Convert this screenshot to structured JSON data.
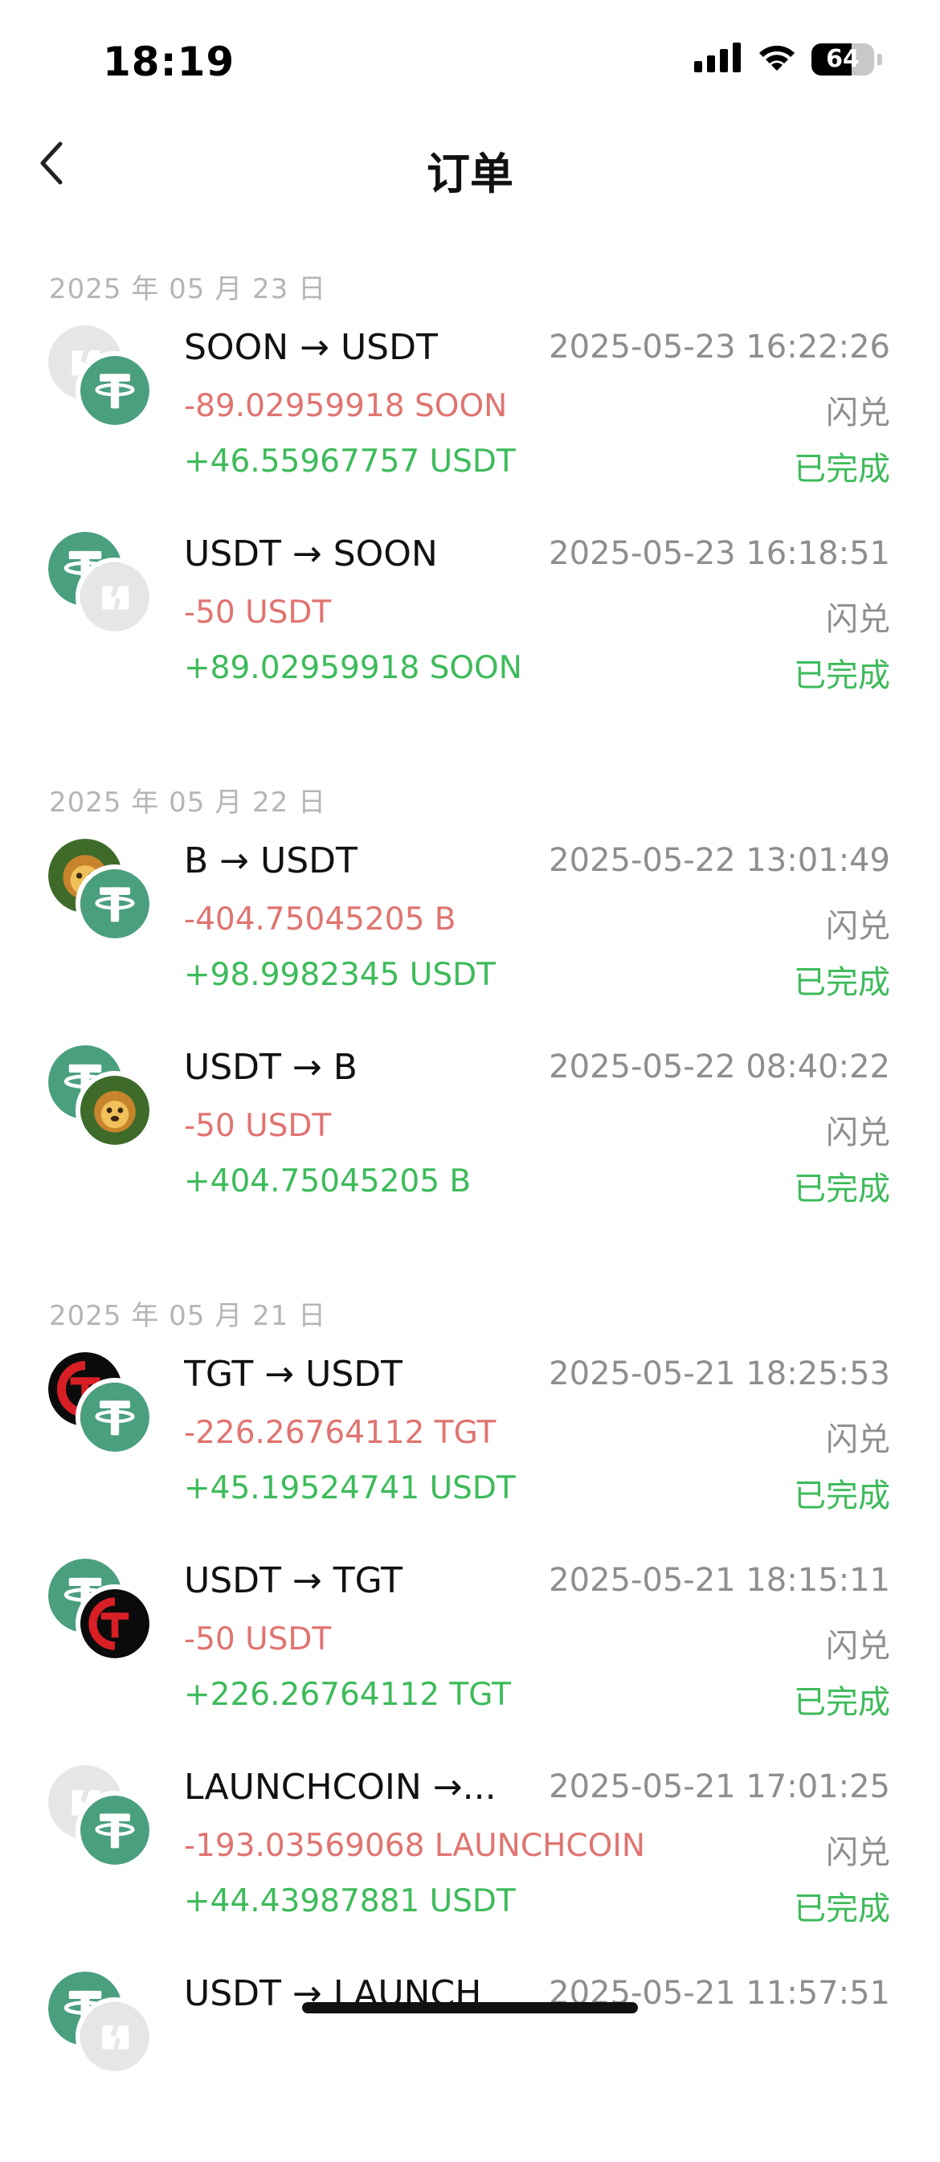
{
  "status_bar": {
    "time": "18:19",
    "battery": "64",
    "battery_level": 0.64,
    "icons": [
      "cellular-signal-icon",
      "wifi-icon",
      "battery-icon"
    ]
  },
  "nav": {
    "back_icon": "chevron-left-icon",
    "title": "订单"
  },
  "colors": {
    "outflow": "#e07471",
    "inflow": "#3dbb5a",
    "muted": "#8e8e8e",
    "date_header": "#b5b5b5",
    "usdt_green": "#4a9f7e"
  },
  "groups": [
    {
      "date": "2025 年 05 月 23 日",
      "orders": [
        {
          "from_icon": "soon-token-icon",
          "to_icon": "usdt-token-icon",
          "pair": "SOON → USDT",
          "out": "-89.02959918 SOON",
          "in": "+46.55967757 USDT",
          "time": "2025-05-23 16:22:26",
          "type": "闪兑",
          "status": "已完成"
        },
        {
          "from_icon": "usdt-token-icon",
          "to_icon": "soon-token-icon",
          "pair": "USDT → SOON",
          "out": "-50 USDT",
          "in": "+89.02959918 SOON",
          "time": "2025-05-23 16:18:51",
          "type": "闪兑",
          "status": "已完成"
        }
      ]
    },
    {
      "date": "2025 年 05 月 22 日",
      "orders": [
        {
          "from_icon": "b-token-icon",
          "to_icon": "usdt-token-icon",
          "pair": "B → USDT",
          "out": "-404.75045205 B",
          "in": "+98.9982345 USDT",
          "time": "2025-05-22 13:01:49",
          "type": "闪兑",
          "status": "已完成"
        },
        {
          "from_icon": "usdt-token-icon",
          "to_icon": "b-token-icon",
          "pair": "USDT → B",
          "out": "-50 USDT",
          "in": "+404.75045205 B",
          "time": "2025-05-22 08:40:22",
          "type": "闪兑",
          "status": "已完成"
        }
      ]
    },
    {
      "date": "2025 年 05 月 21 日",
      "orders": [
        {
          "from_icon": "tgt-token-icon",
          "to_icon": "usdt-token-icon",
          "pair": "TGT → USDT",
          "out": "-226.26764112 TGT",
          "in": "+45.19524741 USDT",
          "time": "2025-05-21 18:25:53",
          "type": "闪兑",
          "status": "已完成"
        },
        {
          "from_icon": "usdt-token-icon",
          "to_icon": "tgt-token-icon",
          "pair": "USDT → TGT",
          "out": "-50 USDT",
          "in": "+226.26764112 TGT",
          "time": "2025-05-21 18:15:11",
          "type": "闪兑",
          "status": "已完成"
        },
        {
          "from_icon": "launchcoin-token-icon",
          "to_icon": "usdt-token-icon",
          "pair": "LAUNCHCOIN →...",
          "out": "-193.03569068 LAUNCHCOIN",
          "in": "+44.43987881 USDT",
          "time": "2025-05-21 17:01:25",
          "type": "闪兑",
          "status": "已完成"
        },
        {
          "from_icon": "usdt-token-icon",
          "to_icon": "launchcoin-token-icon",
          "pair": "USDT → LAUNCH",
          "out": "",
          "in": "",
          "time": "2025-05-21 11:57:51",
          "type": "",
          "status": ""
        }
      ]
    }
  ]
}
